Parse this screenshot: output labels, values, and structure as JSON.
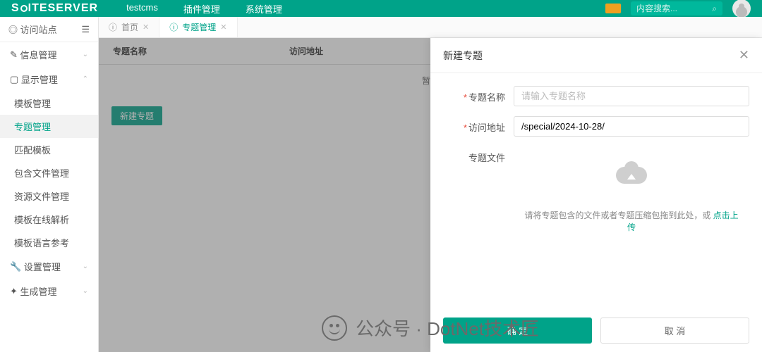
{
  "brand": "SITESERVER",
  "top_menu": {
    "cms": "testcms",
    "plugin": "插件管理",
    "system": "系统管理"
  },
  "search": {
    "placeholder": "内容搜索..."
  },
  "side": {
    "visit": "访问站点",
    "groups": {
      "info": "信息管理",
      "display": "显示管理",
      "settings": "设置管理",
      "generate": "生成管理"
    },
    "display_items": [
      "模板管理",
      "专题管理",
      "匹配模板",
      "包含文件管理",
      "资源文件管理",
      "模板在线解析",
      "模板语言参考"
    ]
  },
  "tabs": {
    "home": "首页",
    "special": "专题管理"
  },
  "table": {
    "col_name": "专题名称",
    "col_url": "访问地址",
    "empty": "暂无",
    "new_btn": "新建专题"
  },
  "panel": {
    "title": "新建专题",
    "label_name": "专题名称",
    "placeholder_name": "请输入专题名称",
    "label_url": "访问地址",
    "value_url": "/special/2024-10-28/",
    "label_file": "专题文件",
    "upload_hint": "请将专题包含的文件或者专题压缩包拖到此处，或 ",
    "upload_link": "点击上传",
    "ok": "确 定",
    "cancel": "取 消"
  },
  "watermark": "公众号 · DotNet技术匠"
}
